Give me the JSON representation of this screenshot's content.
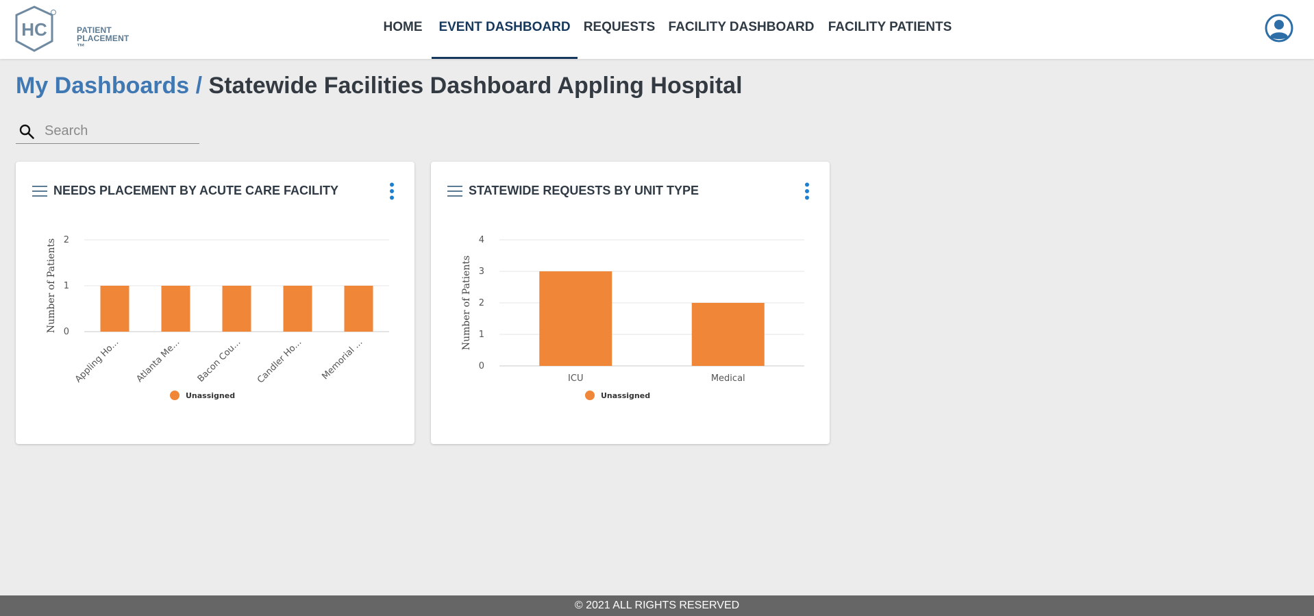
{
  "logo": {
    "mark": "HC",
    "line1": "PATIENT",
    "line2": "PLACEMENT ™"
  },
  "nav": {
    "items": [
      {
        "label": "HOME"
      },
      {
        "label": "EVENT DASHBOARD",
        "active": true
      },
      {
        "label": "REQUESTS"
      },
      {
        "label": "FACILITY DASHBOARD"
      },
      {
        "label": "FACILITY PATIENTS"
      }
    ]
  },
  "user": {
    "icon": "user-circle-icon"
  },
  "page": {
    "breadcrumb_link": "My Dashboards",
    "breadcrumb_separator": "/",
    "title": "Statewide Facilities Dashboard Appling Hospital"
  },
  "search": {
    "placeholder": "Search",
    "value": "",
    "icon": "search-icon"
  },
  "colors": {
    "bar": "#ef8638",
    "accent": "#1d7fd0",
    "nav_active": "#16385c",
    "link": "#3f78b3"
  },
  "cards": [
    {
      "title": "NEEDS PLACEMENT BY ACUTE CARE FACILITY"
    },
    {
      "title": "STATEWIDE REQUESTS BY UNIT TYPE"
    }
  ],
  "chart_data": [
    {
      "type": "bar",
      "categories": [
        "Appling Ho...",
        "Atlanta Me...",
        "Bacon Cou...",
        "Candler Ho...",
        "Memorial ..."
      ],
      "series": [
        {
          "name": "Unassigned",
          "values": [
            1,
            1,
            1,
            1,
            1
          ]
        }
      ],
      "ylabel": "Number of Patients",
      "ylim": [
        0,
        2
      ],
      "yticks": [
        0,
        1,
        2
      ],
      "grid": true,
      "legend": "bottom-center",
      "rotated_labels": true
    },
    {
      "type": "bar",
      "categories": [
        "ICU",
        "Medical"
      ],
      "series": [
        {
          "name": "Unassigned",
          "values": [
            3,
            2
          ]
        }
      ],
      "ylabel": "Number of Patients",
      "ylim": [
        0,
        4
      ],
      "yticks": [
        0,
        1,
        2,
        3,
        4
      ],
      "grid": true,
      "legend": "bottom-center",
      "rotated_labels": false
    }
  ],
  "footer": {
    "text": "© 2021 ALL RIGHTS RESERVED"
  }
}
